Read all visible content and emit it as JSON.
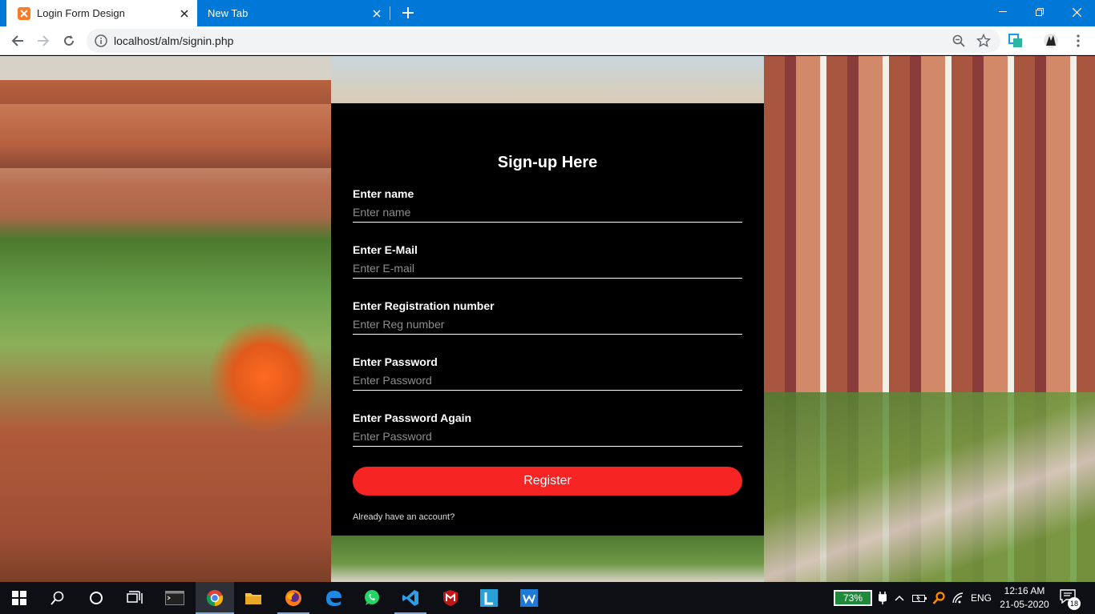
{
  "browser": {
    "tabs": [
      {
        "title": "Login Form Design",
        "active": true
      },
      {
        "title": "New Tab",
        "active": false
      }
    ],
    "url": "localhost/alm/signin.php"
  },
  "form": {
    "title": "Sign-up Here",
    "fields": [
      {
        "label": "Enter name",
        "placeholder": "Enter name"
      },
      {
        "label": "Enter E-Mail",
        "placeholder": "Enter E-mail"
      },
      {
        "label": "Enter Registration number",
        "placeholder": "Enter Reg number"
      },
      {
        "label": "Enter Password",
        "placeholder": "Enter Password"
      },
      {
        "label": "Enter Password Again",
        "placeholder": "Enter Password"
      }
    ],
    "register_label": "Register",
    "account_link": "Already have an account?"
  },
  "taskbar": {
    "battery": "73%",
    "language": "ENG",
    "time": "12:16 AM",
    "date": "21-05-2020",
    "notification_count": "18"
  },
  "colors": {
    "accent": "#0078d7",
    "register": "#f62422"
  }
}
